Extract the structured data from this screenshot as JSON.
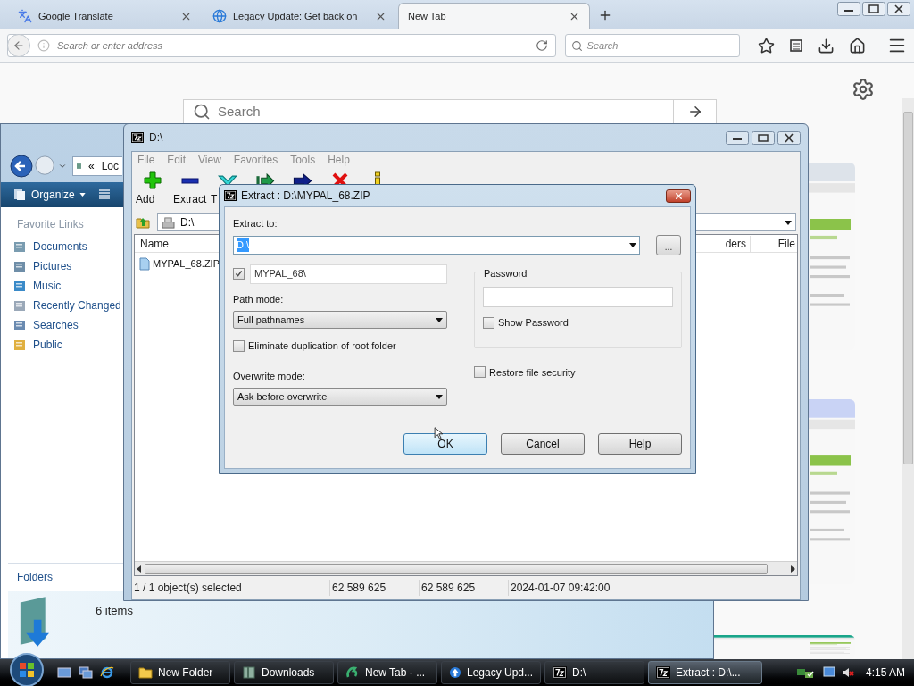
{
  "browser": {
    "tabs": [
      {
        "title": "Google Translate",
        "selected": false,
        "kind": "translate"
      },
      {
        "title": "Legacy Update: Get back on",
        "selected": false,
        "kind": "globe"
      },
      {
        "title": "New Tab",
        "selected": true,
        "kind": "none"
      }
    ],
    "address_placeholder": "Search or enter address",
    "search_placeholder": "Search",
    "page_search_placeholder": "Search"
  },
  "explorer": {
    "address_chevron": "«",
    "address": "Loc",
    "organize": "Organize",
    "favorites_heading": "Favorite Links",
    "links": [
      {
        "label": "Documents",
        "kind": "documents"
      },
      {
        "label": "Pictures",
        "kind": "pictures"
      },
      {
        "label": "Music",
        "kind": "music"
      },
      {
        "label": "Recently Changed",
        "kind": "recent"
      },
      {
        "label": "Searches",
        "kind": "searches"
      },
      {
        "label": "Public",
        "kind": "public"
      }
    ],
    "folders": "Folders",
    "item_count": "6 items"
  },
  "sevenzip": {
    "title": "D:\\",
    "menu": [
      "File",
      "Edit",
      "View",
      "Favorites",
      "Tools",
      "Help"
    ],
    "toolbar": [
      {
        "label": "Add",
        "kind": "add"
      },
      {
        "label": "Extract",
        "kind": "extract"
      },
      {
        "label": "T",
        "kind": "test"
      },
      {
        "kind": "copy"
      },
      {
        "kind": "move"
      },
      {
        "kind": "delete"
      },
      {
        "kind": "info"
      }
    ],
    "path": "D:\\",
    "columns": [
      "Name",
      "ders",
      "File"
    ],
    "rows": [
      {
        "name": "MYPAL_68.ZIP"
      }
    ],
    "status": [
      "1 / 1 object(s) selected",
      "62 589 625",
      "62 589 625",
      "2024-01-07 09:42:00"
    ]
  },
  "dialog": {
    "title": "Extract : D:\\MYPAL_68.ZIP",
    "extract_to_label": "Extract to:",
    "extract_to": "D:\\",
    "extract_to_selected": true,
    "browse": "...",
    "subfolder": {
      "checked": true,
      "value": "MYPAL_68\\"
    },
    "path_mode_label": "Path mode:",
    "path_mode": "Full pathnames",
    "eliminate": {
      "label": "Eliminate duplication of root folder",
      "checked": false
    },
    "overwrite_label": "Overwrite mode:",
    "overwrite": "Ask before overwrite",
    "password_label": "Password",
    "show_password": {
      "label": "Show Password",
      "checked": false
    },
    "restore_security": {
      "label": "Restore file security",
      "checked": false
    },
    "buttons": [
      {
        "label": "OK",
        "default": true
      },
      {
        "label": "Cancel",
        "default": false
      },
      {
        "label": "Help",
        "default": false
      }
    ]
  },
  "taskbar": {
    "buttons": [
      {
        "label": "New Folder",
        "kind": "folder",
        "selected": false
      },
      {
        "label": "Downloads",
        "kind": "library",
        "selected": false
      },
      {
        "label": "New Tab - ...",
        "kind": "browser",
        "selected": false
      },
      {
        "label": "Legacy Upd...",
        "kind": "globe",
        "selected": false
      },
      {
        "label": "D:\\",
        "kind": "sevenzip",
        "selected": false
      },
      {
        "label": "Extract : D:\\...",
        "kind": "sevenzip",
        "selected": true
      }
    ],
    "clock": "4:15 AM"
  }
}
